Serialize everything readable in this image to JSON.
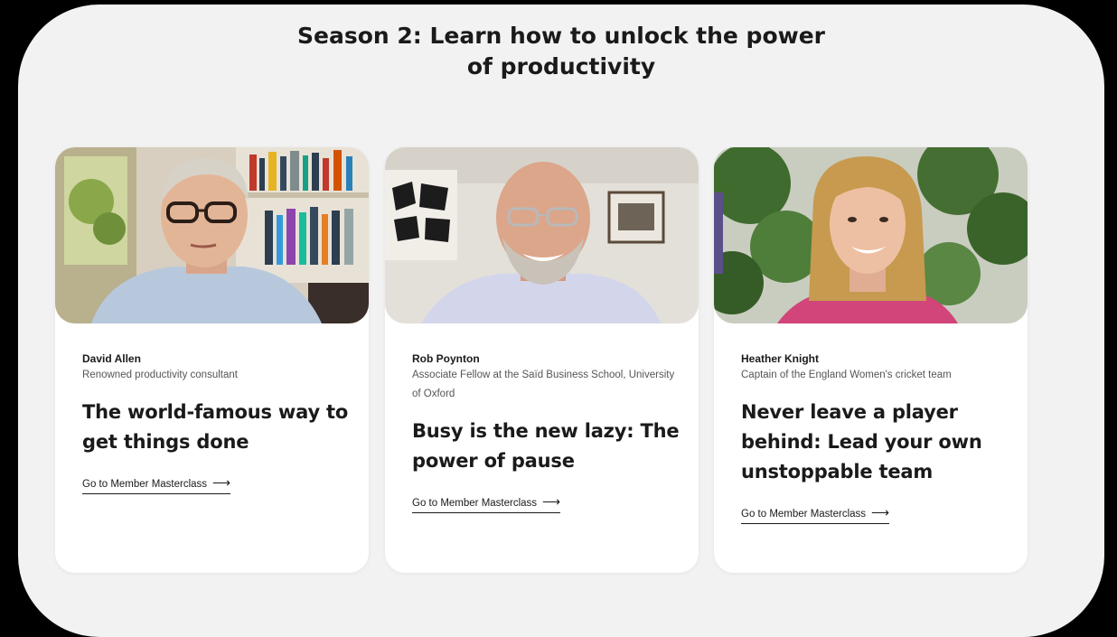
{
  "section": {
    "title_line1": "Season 2: Learn how to unlock the power",
    "title_line2": "of productivity"
  },
  "cards": [
    {
      "name": "David Allen",
      "role": "Renowned productivity consultant",
      "headline": "The world-famous way to get things done",
      "cta_label": "Go to Member Masterclass",
      "cta_arrow": "⟶"
    },
    {
      "name": "Rob Poynton",
      "role": "Associate Fellow at the Saïd Business School, University of Oxford",
      "headline": "Busy is the new lazy: The power of pause",
      "cta_label": "Go to Member Masterclass",
      "cta_arrow": "⟶"
    },
    {
      "name": "Heather Knight",
      "role": "Captain of the England Women's cricket team",
      "headline": "Never leave a player behind: Lead your own unstoppable team",
      "cta_label": "Go to Member Masterclass",
      "cta_arrow": "⟶"
    }
  ],
  "colors": {
    "page_background": "#000000",
    "frame_background": "#f2f2f2",
    "card_background": "#ffffff",
    "text_primary": "#1a1a1a",
    "text_secondary": "#555555"
  }
}
